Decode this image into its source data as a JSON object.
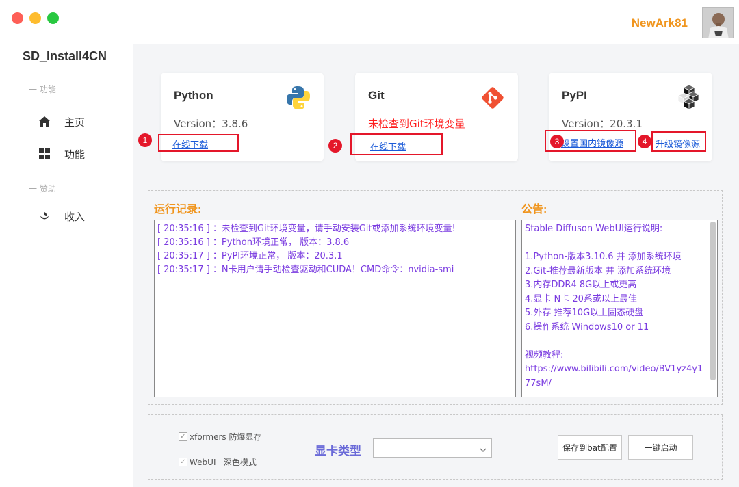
{
  "window": {
    "user_name": "NewArk81"
  },
  "sidebar": {
    "app_title": "SD_Install4CN",
    "section_function": "一 功能",
    "section_sponsor": "一 赞助",
    "items": [
      {
        "label": "主页",
        "icon": "home-icon"
      },
      {
        "label": "功能",
        "icon": "grid-icon"
      },
      {
        "label": "收入",
        "icon": "income-icon"
      }
    ]
  },
  "cards": {
    "python": {
      "title": "Python",
      "version": "Version：3.8.6",
      "link": "在线下载",
      "badge": "1",
      "logo": "python-logo-icon"
    },
    "git": {
      "title": "Git",
      "warning": "未检查到Git环境变量",
      "link": "在线下载",
      "badge": "2",
      "logo": "git-logo-icon"
    },
    "pypi": {
      "title": "PyPI",
      "version": "Version：20.3.1",
      "link_mirror": "设置国内镜像源",
      "link_upgrade": "升级镜像源",
      "badge_mirror": "3",
      "badge_upgrade": "4",
      "logo": "pypi-logo-icon"
    }
  },
  "log": {
    "heading": "运行记录:",
    "lines": [
      "[ 20:35:16 ] ：未检查到Git环境变量，请手动安装Git或添加系统环境变量!",
      "[ 20:35:16 ] ：Python环境正常，  版本：3.8.6",
      "[ 20:35:17 ] ：PyPI环境正常，      版本：20.3.1",
      "[ 20:35:17 ] ：N卡用户请手动检查驱动和CUDA！CMD命令：nvidia-smi"
    ]
  },
  "notice": {
    "heading": "公告:",
    "lines": [
      "Stable Diffuson WebUI运行说明:",
      "",
      "1.Python-版本3.10.6 并 添加系统环境",
      "2.Git-推荐最新版本   并 添加系统环境",
      "3.内存DDR4 8G以上或更高",
      "4.显卡 N卡 20系或以上最佳",
      "5.外存 推荐10G以上固态硬盘",
      "6.操作系统 Windows10 or 11",
      "",
      "视频教程:",
      "https://www.bilibili.com/video/BV1yz4y177sM/"
    ]
  },
  "options": {
    "xformers_label": "xformers 防爆显存",
    "xformers_checked": true,
    "webui_dark_label": "WebUI   深色模式",
    "webui_dark_checked": true,
    "gpu_type_label": "显卡类型",
    "gpu_type_value": "",
    "save_bat_button": "保存到bat配置",
    "one_click_start_button": "一键启动"
  },
  "colors": {
    "accent_orange": "#f0951e",
    "highlight_red": "#e4172a",
    "log_purple": "#7a3be0",
    "link_blue": "#1a5ad8"
  }
}
